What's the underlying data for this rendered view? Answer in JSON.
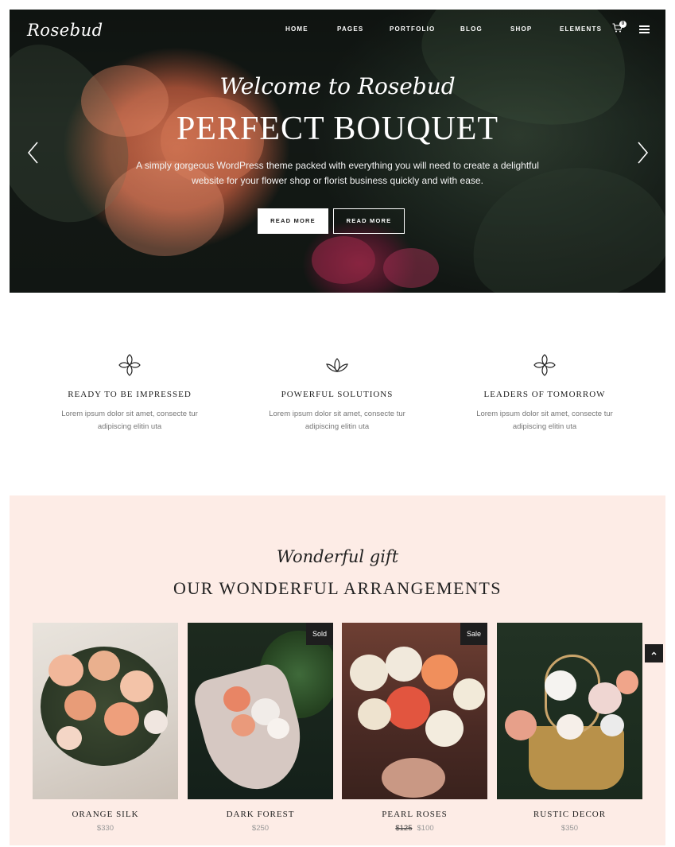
{
  "header": {
    "logo": "Rosebud",
    "nav": [
      {
        "label": "HOME"
      },
      {
        "label": "PAGES"
      },
      {
        "label": "PORTFOLIO"
      },
      {
        "label": "BLOG"
      },
      {
        "label": "SHOP"
      },
      {
        "label": "ELEMENTS"
      }
    ],
    "cart_count": "0",
    "icons": {
      "cart": "cart-icon",
      "menu": "hamburger-menu-icon"
    }
  },
  "hero": {
    "script": "Welcome to Rosebud",
    "title": "PERFECT BOUQUET",
    "description": "A simply gorgeous WordPress theme packed with everything you will need to create a delightful website for your flower shop or florist business quickly and with ease.",
    "button_primary": "READ MORE",
    "button_secondary": "READ MORE",
    "icons": {
      "prev": "chevron-left-icon",
      "next": "chevron-right-icon"
    }
  },
  "features": [
    {
      "icon": "four-petal-flower-icon",
      "title": "READY TO BE IMPRESSED",
      "text": "Lorem ipsum dolor sit amet, consecte tur adipiscing elitin uta"
    },
    {
      "icon": "lotus-icon",
      "title": "POWERFUL SOLUTIONS",
      "text": "Lorem ipsum dolor sit amet, consecte tur adipiscing elitin uta"
    },
    {
      "icon": "four-petal-flower-icon",
      "title": "LEADERS OF TOMORROW",
      "text": "Lorem ipsum dolor sit amet, consecte tur adipiscing elitin uta"
    }
  ],
  "arrangements": {
    "script": "Wonderful gift",
    "title": "OUR WONDERFUL ARRANGEMENTS",
    "products": [
      {
        "name": "ORANGE SILK",
        "price": "$330",
        "old_price": "",
        "badge": ""
      },
      {
        "name": "DARK FOREST",
        "price": "$250",
        "old_price": "",
        "badge": "Sold"
      },
      {
        "name": "PEARL ROSES",
        "price": "$100",
        "old_price": "$125",
        "badge": "Sale"
      },
      {
        "name": "RUSTIC DECOR",
        "price": "$350",
        "old_price": "",
        "badge": ""
      }
    ]
  },
  "scroll_top_icon": "chevron-up-icon",
  "colors": {
    "section_bg": "#fdece6",
    "badge_bg": "#1e1e1e",
    "hero_accent": "#d97a57"
  }
}
